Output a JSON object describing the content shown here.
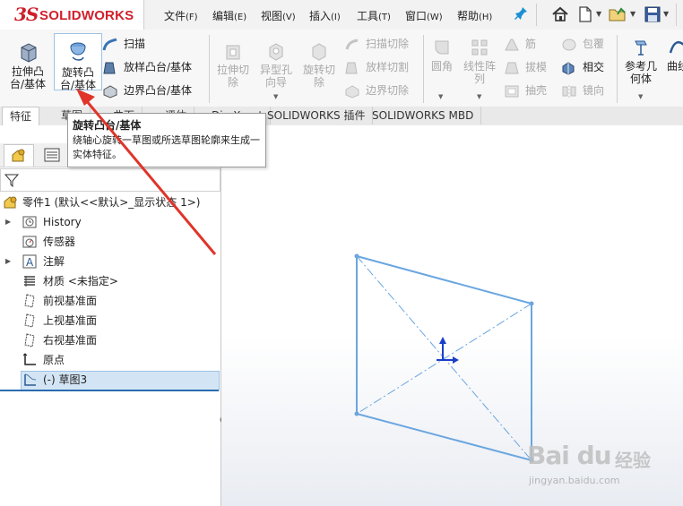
{
  "app": {
    "logo_ds": "3S",
    "logo_text": "SOLIDWORKS"
  },
  "menu": [
    {
      "label": "文件",
      "accel": "(F)"
    },
    {
      "label": "编辑",
      "accel": "(E)"
    },
    {
      "label": "视图",
      "accel": "(V)"
    },
    {
      "label": "插入",
      "accel": "(I)"
    },
    {
      "label": "工具",
      "accel": "(T)"
    },
    {
      "label": "窗口",
      "accel": "(W)"
    },
    {
      "label": "帮助",
      "accel": "(H)"
    }
  ],
  "ribbon": {
    "extrude_boss": "拉伸凸\n台/基体",
    "revolve_boss": "旋转凸\n台/基体",
    "sweep": "扫描",
    "loft_boss": "放样凸台/基体",
    "boundary_boss": "边界凸台/基体",
    "extrude_cut": "拉伸切\n除",
    "hole_wizard": "异型孔\n向导",
    "revolve_cut": "旋转切\n除",
    "sweep_cut": "扫描切除",
    "loft_cut": "放样切割",
    "boundary_cut": "边界切除",
    "fillet": "圆角",
    "linear_pattern": "线性阵\n列",
    "rib": "筋",
    "draft": "拔模",
    "shell": "抽壳",
    "wrap": "包覆",
    "intersect": "相交",
    "mirror": "镜向",
    "ref_geometry": "参考几\n何体",
    "curves": "曲线"
  },
  "tabs": [
    "特征",
    "草图",
    "曲面",
    "评估",
    "DimXpert",
    "SOLIDWORKS 插件",
    "SOLIDWORKS MBD"
  ],
  "tooltip": {
    "title": "旋转凸台/基体",
    "description": "绕轴心旋转一草图或所选草图轮廓来生成一实体特征。"
  },
  "tree": {
    "root": "零件1  (默认<<默认>_显示状态 1>)",
    "items": [
      {
        "label": "History",
        "icon": "history-icon",
        "expandable": true
      },
      {
        "label": "传感器",
        "icon": "sensor-icon",
        "expandable": false
      },
      {
        "label": "注解",
        "icon": "annotation-icon",
        "expandable": true
      },
      {
        "label": "材质 <未指定>",
        "icon": "material-icon",
        "expandable": false
      },
      {
        "label": "前视基准面",
        "icon": "plane-icon",
        "expandable": false
      },
      {
        "label": "上视基准面",
        "icon": "plane-icon",
        "expandable": false
      },
      {
        "label": "右视基准面",
        "icon": "plane-icon",
        "expandable": false
      },
      {
        "label": "原点",
        "icon": "origin-icon",
        "expandable": false
      },
      {
        "label": "(-) 草图3",
        "icon": "sketch-icon",
        "expandable": false
      }
    ]
  },
  "watermark": {
    "main": "Bai du",
    "sub": "经验",
    "url": "jingyan.baidu.com"
  },
  "colors": {
    "sketch": "#6aa6e0",
    "arrow": "#e0342a",
    "accent": "#2b6cb0",
    "brand": "#cc1f2b"
  }
}
